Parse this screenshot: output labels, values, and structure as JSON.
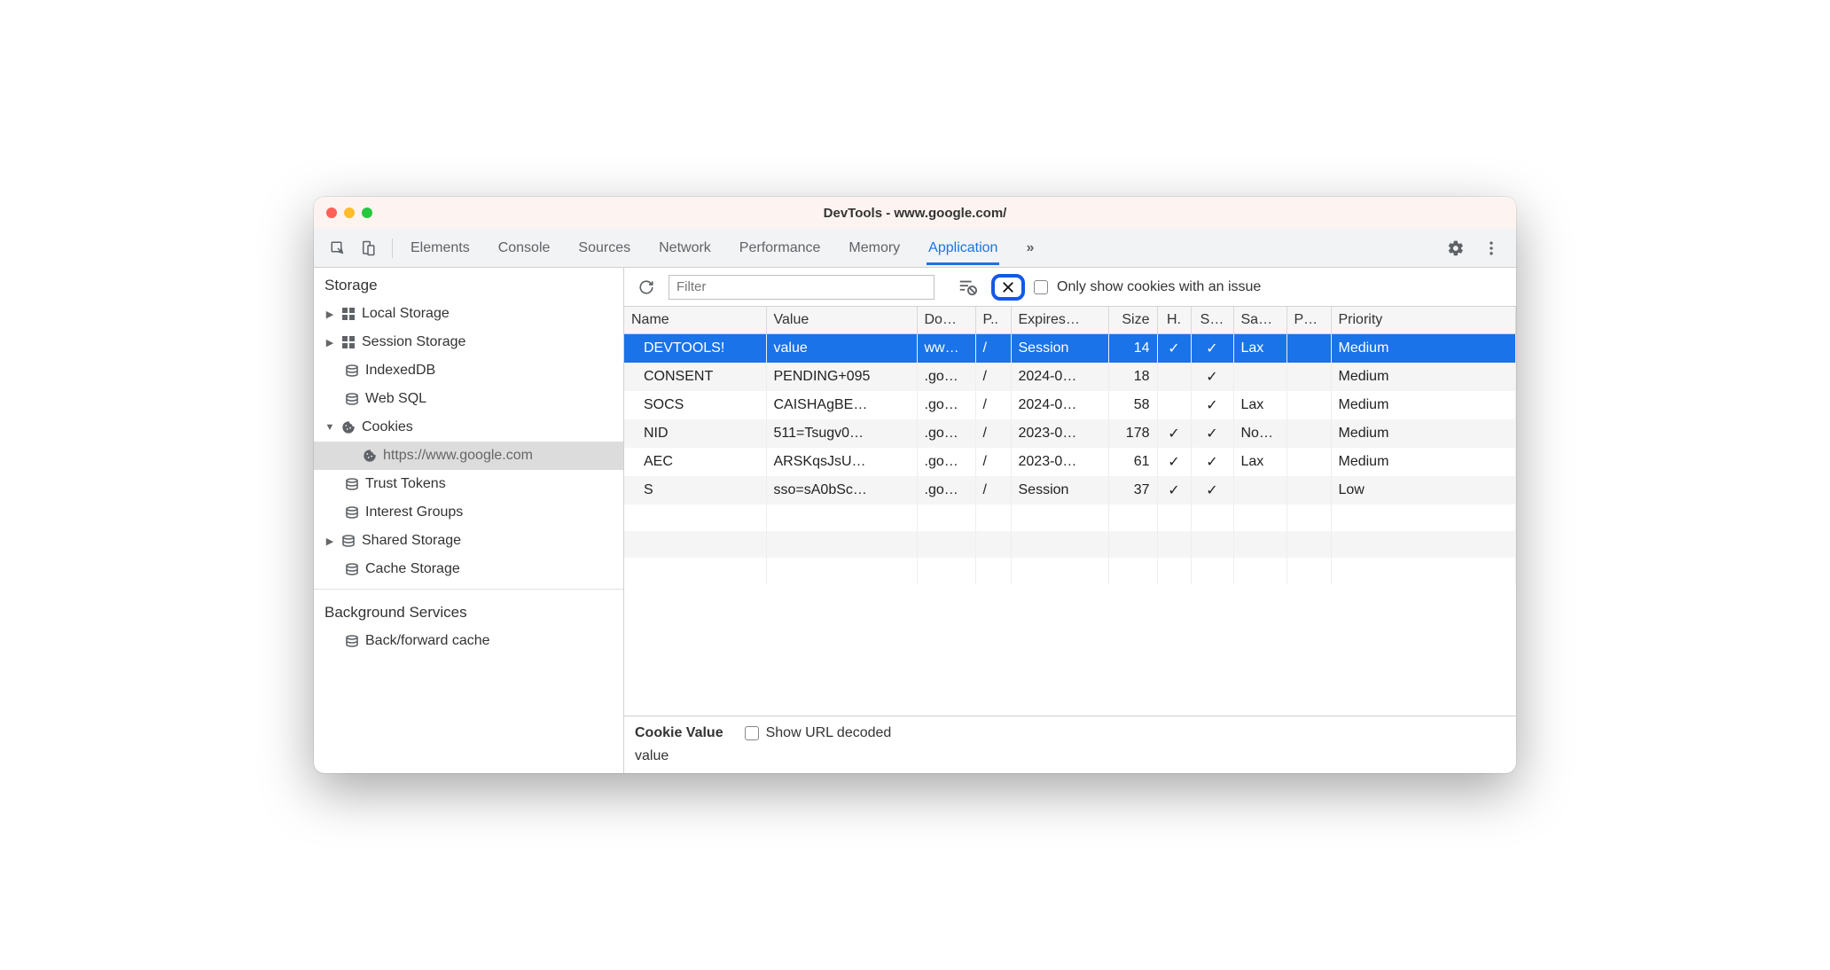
{
  "title": "DevTools - www.google.com/",
  "tabs": [
    "Elements",
    "Console",
    "Sources",
    "Network",
    "Performance",
    "Memory",
    "Application"
  ],
  "active_tab": 6,
  "sidebar": {
    "section1": "Storage",
    "section2": "Background Services",
    "items": [
      {
        "label": "Local Storage",
        "arrow": "▶",
        "icon": "grid"
      },
      {
        "label": "Session Storage",
        "arrow": "▶",
        "icon": "grid"
      },
      {
        "label": "IndexedDB",
        "arrow": "",
        "icon": "db"
      },
      {
        "label": "Web SQL",
        "arrow": "",
        "icon": "db"
      },
      {
        "label": "Cookies",
        "arrow": "▼",
        "icon": "cookie"
      },
      {
        "label": "https://www.google.com",
        "arrow": "",
        "icon": "cookie"
      },
      {
        "label": "Trust Tokens",
        "arrow": "",
        "icon": "db"
      },
      {
        "label": "Interest Groups",
        "arrow": "",
        "icon": "db"
      },
      {
        "label": "Shared Storage",
        "arrow": "▶",
        "icon": "db"
      },
      {
        "label": "Cache Storage",
        "arrow": "",
        "icon": "db"
      }
    ],
    "bg_items": [
      {
        "label": "Back/forward cache",
        "arrow": "",
        "icon": "db"
      }
    ]
  },
  "filterbar": {
    "placeholder": "Filter",
    "only_issue_label": "Only show cookies with an issue"
  },
  "columns": [
    "Name",
    "Value",
    "Do…",
    "P..",
    "Expires…",
    "Size",
    "H.",
    "S…",
    "Sa…",
    "P…",
    "Priority"
  ],
  "rows": [
    {
      "name": "DEVTOOLS!",
      "value": "value",
      "domain": "ww…",
      "path": "/",
      "expires": "Session",
      "size": "14",
      "http": "✓",
      "secure": "✓",
      "same": "Lax",
      "pk": "",
      "priority": "Medium",
      "sel": true
    },
    {
      "name": "CONSENT",
      "value": "PENDING+095",
      "domain": ".go…",
      "path": "/",
      "expires": "2024-0…",
      "size": "18",
      "http": "",
      "secure": "✓",
      "same": "",
      "pk": "",
      "priority": "Medium"
    },
    {
      "name": "SOCS",
      "value": "CAISHAgBE…",
      "domain": ".go…",
      "path": "/",
      "expires": "2024-0…",
      "size": "58",
      "http": "",
      "secure": "✓",
      "same": "Lax",
      "pk": "",
      "priority": "Medium"
    },
    {
      "name": "NID",
      "value": "511=Tsugv0…",
      "domain": ".go…",
      "path": "/",
      "expires": "2023-0…",
      "size": "178",
      "http": "✓",
      "secure": "✓",
      "same": "No…",
      "pk": "",
      "priority": "Medium"
    },
    {
      "name": "AEC",
      "value": "ARSKqsJsU…",
      "domain": ".go…",
      "path": "/",
      "expires": "2023-0…",
      "size": "61",
      "http": "✓",
      "secure": "✓",
      "same": "Lax",
      "pk": "",
      "priority": "Medium"
    },
    {
      "name": "S",
      "value": "sso=sA0bSc…",
      "domain": ".go…",
      "path": "/",
      "expires": "Session",
      "size": "37",
      "http": "✓",
      "secure": "✓",
      "same": "",
      "pk": "",
      "priority": "Low"
    }
  ],
  "detail": {
    "label": "Cookie Value",
    "url_decoded_label": "Show URL decoded",
    "value": "value"
  }
}
